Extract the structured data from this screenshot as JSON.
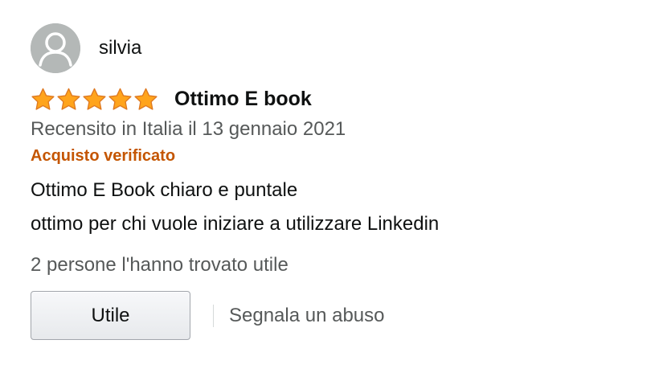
{
  "review": {
    "author": "silvia",
    "rating": 5,
    "rating_max": 5,
    "title": "Ottimo E book",
    "meta": "Recensito in Italia il 13 gennaio 2021",
    "verified": "Acquisto verificato",
    "body_lines": [
      "Ottimo E Book chiaro e puntale",
      "ottimo per chi vuole iniziare a utilizzare Linkedin"
    ],
    "helpful_text": "2 persone l'hanno trovato utile",
    "useful_button": "Utile",
    "report_link": "Segnala un abuso"
  },
  "icons": {
    "avatar": "default-avatar-icon",
    "star": "star-icon"
  },
  "colors": {
    "star_fill": "#ffa41c",
    "star_stroke": "#de7921",
    "verified": "#c45500",
    "muted_text": "#565959",
    "avatar_bg": "#b4b8b7"
  }
}
